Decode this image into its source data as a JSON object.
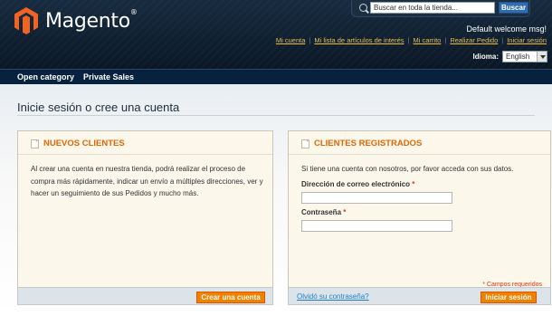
{
  "header": {
    "logo_text": "Magento",
    "logo_reg": "®",
    "search": {
      "placeholder": "Buscar en toda la tienda...",
      "button_label": "Buscar"
    },
    "welcome": "Default welcome msg!",
    "links": [
      {
        "label": "Mi cuenta"
      },
      {
        "label": "Mi lista de artículos de interés"
      },
      {
        "label": "Mi carrito"
      },
      {
        "label": "Realizar Pedido"
      },
      {
        "label": "Iniciar sesión"
      }
    ],
    "language": {
      "label": "Idioma:",
      "selected": "English"
    }
  },
  "nav": {
    "items": [
      {
        "label": "Open category"
      },
      {
        "label": "Private Sales"
      }
    ]
  },
  "main": {
    "title": "Inicie sesión o cree una cuenta",
    "new_customers": {
      "title": "NUEVOS CLIENTES",
      "text": "Al crear una cuenta en nuestra tienda, podrá realizar el proceso de compra más rápidamente, indicar un envío a múltiples direcciones, ver y hacer un seguimiento de sus Pedidos y mucho más.",
      "button_label": "Crear una cuenta"
    },
    "registered": {
      "title": "CLIENTES REGISTRADOS",
      "text": "Si tiene una cuenta con nosotros, por favor acceda con sus datos.",
      "email_label": "Dirección de correo electrónico",
      "password_label": "Contraseña",
      "required_marker": "*",
      "required_note": "* Campos requeridos",
      "forgot_link": "Olvidó su contraseña?",
      "button_label": "Iniciar sesión"
    }
  },
  "colors": {
    "accent_orange": "#f18200",
    "title_orange": "#e26703",
    "link_blue": "#1e7ec8",
    "header_link_gold": "#ebbc4e",
    "required_red": "#eb340a",
    "nav_bg": "#06223e",
    "logo_orange": "#f26322"
  },
  "icons": [
    "magento-logo-icon",
    "search-icon",
    "chevron-down-icon",
    "document-icon"
  ]
}
